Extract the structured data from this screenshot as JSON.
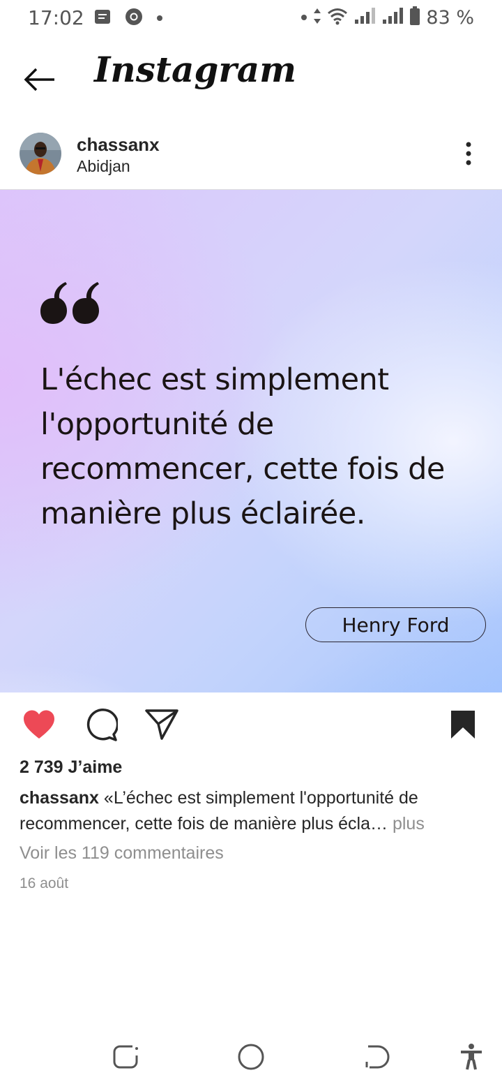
{
  "status_bar": {
    "time": "17:02",
    "battery_text": "83 %",
    "left_icons": [
      "message-icon",
      "chrome-icon",
      "dot-icon"
    ],
    "right_icons": [
      "dot-icon",
      "data-arrows-icon",
      "wifi-icon",
      "signal-icon",
      "signal-icon",
      "battery-icon"
    ]
  },
  "header": {
    "title": "Instagram",
    "back_icon": "arrow-left-icon"
  },
  "post": {
    "username": "chassanx",
    "location": "Abidjan",
    "more_icon": "more-vertical-icon",
    "image": {
      "quote": "L'échec est simplement l'opportunité de recommencer, cette fois de manière plus éclairée.",
      "author": "Henry Ford"
    },
    "actions": {
      "liked": true,
      "saved": true,
      "icons": [
        "heart-icon",
        "comment-icon",
        "share-icon",
        "bookmark-icon"
      ]
    },
    "likes": "2 739 J’aime",
    "caption": {
      "username": "chassanx",
      "text": " «L’échec est simplement l'opportunité de recommencer, cette fois de manière plus écla…",
      "more": " plus"
    },
    "comments_link": "Voir les 119 commentaires",
    "date": "16 août"
  },
  "nav_bar": {
    "icons": [
      "recents-icon",
      "home-icon",
      "back-icon",
      "accessibility-icon"
    ]
  },
  "colors": {
    "like_red": "#ed4956",
    "text_primary": "#262626",
    "text_secondary": "#8e8e8e"
  }
}
